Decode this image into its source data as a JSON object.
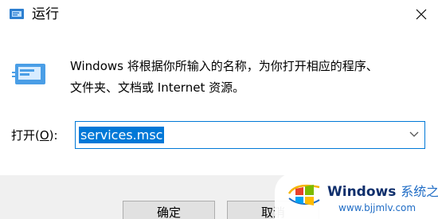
{
  "window": {
    "title": "运行",
    "close_icon": "close-icon"
  },
  "prompt": {
    "icon": "run-dialog-icon",
    "line1": "Windows 将根据你所输入的名称，为你打开相应的程序、",
    "line2": "文件夹、文档或 Internet 资源。"
  },
  "open_field": {
    "label_prefix": "打开(",
    "label_accel": "O",
    "label_suffix": "):",
    "value": "services.msc",
    "dropdown_icon": "chevron-down-icon"
  },
  "buttons": {
    "ok": "确定",
    "cancel": "取消"
  },
  "watermark": {
    "brand": "Windows",
    "brand_cn": "系统之家",
    "url": "www.bjjmlv.com",
    "logo": "windows-logo-icon"
  },
  "colors": {
    "accent": "#0078d7",
    "footer_bg": "#f0f0f0",
    "button_bg": "#e1e1e1"
  }
}
